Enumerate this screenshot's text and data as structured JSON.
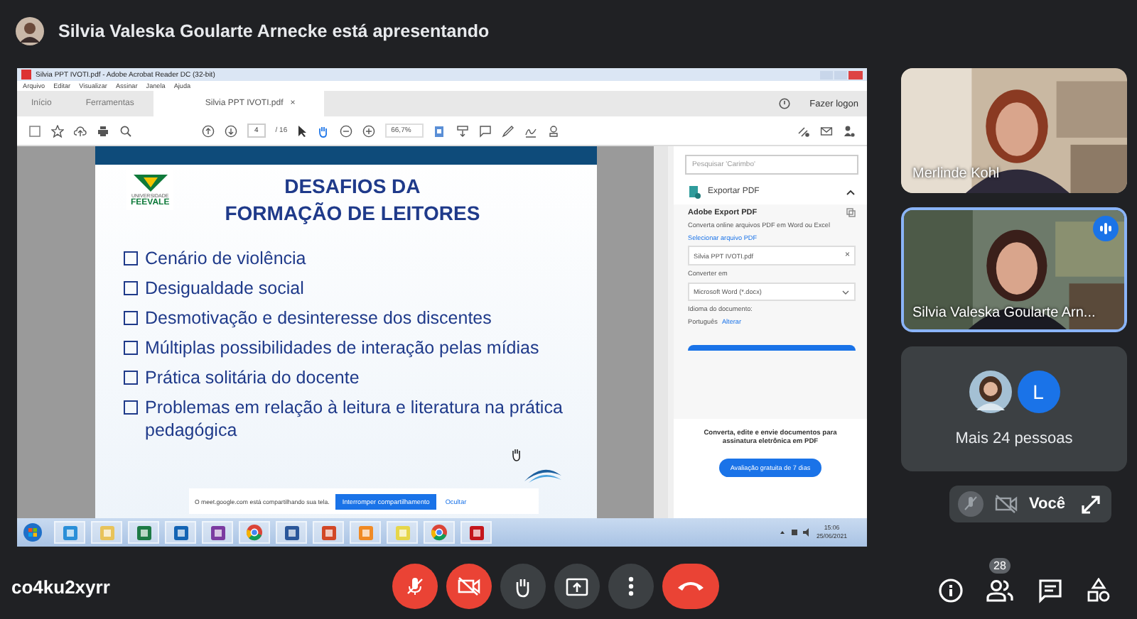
{
  "presenter_bar": {
    "text": "Silvia Valeska Goularte Arnecke está apresentando"
  },
  "shared_screen": {
    "window_title": "Silvia PPT IVOTI.pdf - Adobe Acrobat Reader DC (32-bit)",
    "menu": [
      "Arquivo",
      "Editar",
      "Visualizar",
      "Assinar",
      "Janela",
      "Ajuda"
    ],
    "tabs": [
      {
        "label": "Início",
        "selected": false
      },
      {
        "label": "Ferramentas",
        "selected": false
      },
      {
        "label": "Silvia PPT IVOTI.pdf",
        "selected": true
      }
    ],
    "tab_close": "×",
    "login": "Fazer logon",
    "page_current": "4",
    "page_total": "/ 16",
    "zoom": "66,7%",
    "slide": {
      "logo_top": "UNIVERSIDADE",
      "logo_name": "FEEVALE",
      "title_lines": [
        "DESAFIOS DA",
        "FORMAÇÃO DE LEITORES"
      ],
      "bullets": [
        "Cenário de violência",
        "Desigualdade social",
        "Desmotivação e desinteresse dos discentes",
        "Múltiplas possibilidades de interação pelas mídias",
        "Prática solitária do docente",
        "Problemas em relação à leitura e literatura na prática pedagógica"
      ]
    },
    "side_panel": {
      "search_placeholder": "Pesquisar 'Carimbo'",
      "export_label": "Exportar PDF",
      "heading": "Adobe Export PDF",
      "description": "Converta online arquivos PDF em Word ou Excel",
      "select_link": "Selecionar arquivo PDF",
      "file": "Silvia PPT IVOTI.pdf",
      "file_clear": "×",
      "convert_label": "Converter em",
      "format": "Microsoft Word (*.docx)",
      "language_label": "Idioma do documento:",
      "language": "Português",
      "change_link": "Alterar",
      "promo": "Converta, edite e envie documentos para assinatura eletrônica em PDF",
      "trial_button": "Avaliação gratuita de 7 dias"
    },
    "share_notice": {
      "text": "O meet.google.com está compartilhando sua tela.",
      "stop_button": "Interromper compartilhamento",
      "hide_button": "Ocultar"
    },
    "taskbar": {
      "apps": [
        {
          "kind": "start"
        },
        {
          "kind": "browser"
        },
        {
          "kind": "folder"
        },
        {
          "kind": "spreadsheet"
        },
        {
          "kind": "mail"
        },
        {
          "kind": "notes"
        },
        {
          "kind": "chrome"
        },
        {
          "kind": "document"
        },
        {
          "kind": "slides"
        },
        {
          "kind": "media"
        },
        {
          "kind": "sticky"
        },
        {
          "kind": "chrome"
        },
        {
          "kind": "pdf"
        }
      ],
      "time": "15:06",
      "date": "25/06/2021"
    }
  },
  "participants": [
    {
      "name": "Merlinde Kohl",
      "speaking": false
    },
    {
      "name": "Silvia Valeska Goularte Arn...",
      "speaking": true
    }
  ],
  "others": {
    "initial": "L",
    "label": "Mais 24 pessoas"
  },
  "self": {
    "label": "Você"
  },
  "meeting_code": "co4ku2xyrr",
  "people_count": "28"
}
